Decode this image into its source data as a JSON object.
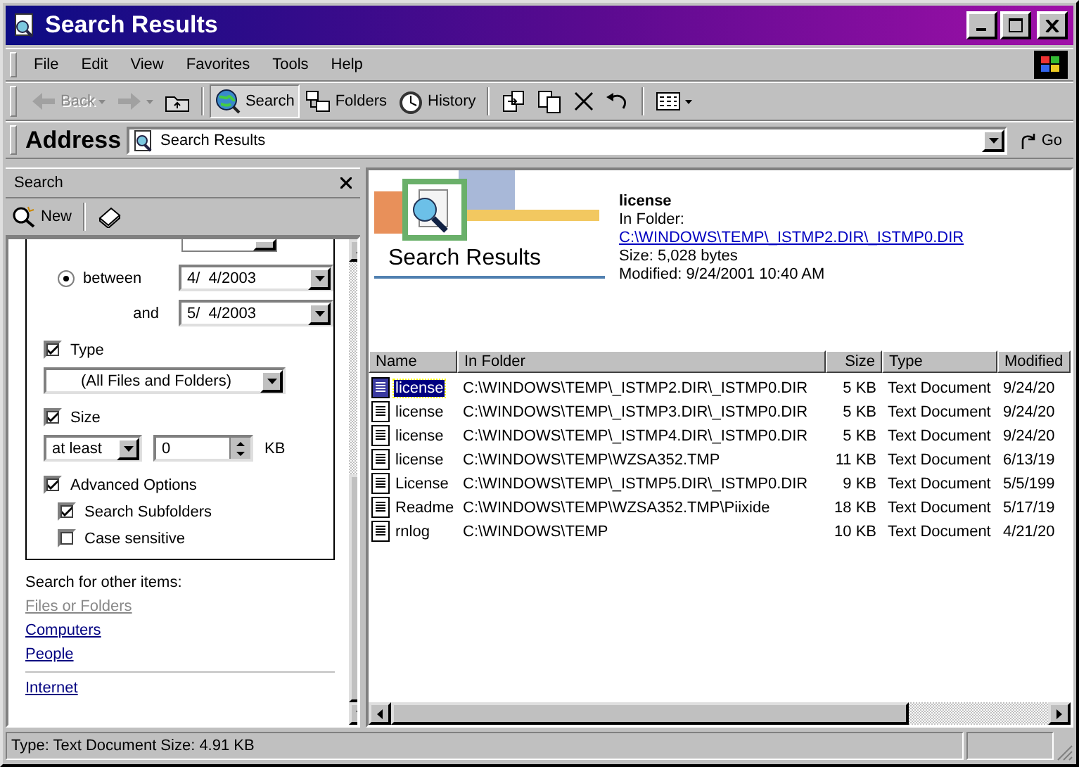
{
  "window": {
    "title": "Search Results"
  },
  "menu": [
    {
      "label": "File"
    },
    {
      "label": "Edit"
    },
    {
      "label": "View"
    },
    {
      "label": "Favorites"
    },
    {
      "label": "Tools"
    },
    {
      "label": "Help"
    }
  ],
  "toolbar": [
    [
      {
        "kind": "back",
        "label": "Back",
        "disabled": true,
        "dropdown": true,
        "selected": false
      },
      {
        "kind": "forward",
        "disabled": true,
        "dropdown": true,
        "selected": false
      },
      {
        "kind": "up",
        "disabled": false,
        "dropdown": false,
        "selected": false
      }
    ],
    [
      {
        "kind": "search",
        "label": "Search",
        "disabled": false,
        "dropdown": false,
        "selected": true
      },
      {
        "kind": "folders",
        "label": "Folders",
        "disabled": false,
        "dropdown": false,
        "selected": false
      },
      {
        "kind": "history",
        "label": "History",
        "disabled": false,
        "dropdown": false,
        "selected": false
      }
    ],
    [
      {
        "kind": "move",
        "disabled": false,
        "dropdown": false,
        "selected": false
      },
      {
        "kind": "copy",
        "disabled": false,
        "dropdown": false,
        "selected": false
      },
      {
        "kind": "delete",
        "disabled": false,
        "dropdown": false,
        "selected": false
      },
      {
        "kind": "undo",
        "disabled": false,
        "dropdown": false,
        "selected": false
      }
    ],
    [
      {
        "kind": "views",
        "disabled": false,
        "dropdown": true,
        "selected": false
      }
    ]
  ],
  "address": {
    "label": "Address",
    "value": "Search Results",
    "go": "Go"
  },
  "search_pane": {
    "title": "Search",
    "new_label": "New",
    "date_range": {
      "selected": true,
      "label": "between",
      "from": "4/  4/2003",
      "and_label": "and",
      "to": "5/  4/2003"
    },
    "type": {
      "label": "Type",
      "checked": true,
      "value": "(All Files and Folders)"
    },
    "size": {
      "label": "Size",
      "checked": true,
      "mode": "at least",
      "value": "0",
      "unit": "KB"
    },
    "advanced": {
      "label": "Advanced Options",
      "checked": true,
      "options": [
        {
          "label": "Search Subfolders",
          "checked": true
        },
        {
          "label": "Case sensitive",
          "checked": false
        }
      ]
    },
    "other_items": {
      "label": "Search for other items:",
      "link_groups": [
        [
          {
            "label": "Files or Folders",
            "disabled": true
          },
          {
            "label": "Computers",
            "disabled": false
          },
          {
            "label": "People",
            "disabled": false
          }
        ],
        [
          {
            "label": "Internet",
            "disabled": false
          }
        ]
      ]
    }
  },
  "details": {
    "banner": "Search Results",
    "name": "license",
    "in_folder_label": "In Folder:",
    "folder": "C:\\WINDOWS\\TEMP\\_ISTMP2.DIR\\_ISTMP0.DIR",
    "size": "Size: 5,028 bytes",
    "modified": "Modified: 9/24/2001 10:40 AM"
  },
  "table": {
    "columns": [
      "Name",
      "In Folder",
      "Size",
      "Type",
      "Modified"
    ],
    "rows": [
      {
        "name": "license",
        "folder": "C:\\WINDOWS\\TEMP\\_ISTMP2.DIR\\_ISTMP0.DIR",
        "size": "5 KB",
        "type": "Text Document",
        "modified": "9/24/20",
        "selected": true
      },
      {
        "name": "license",
        "folder": "C:\\WINDOWS\\TEMP\\_ISTMP3.DIR\\_ISTMP0.DIR",
        "size": "5 KB",
        "type": "Text Document",
        "modified": "9/24/20",
        "selected": false
      },
      {
        "name": "license",
        "folder": "C:\\WINDOWS\\TEMP\\_ISTMP4.DIR\\_ISTMP0.DIR",
        "size": "5 KB",
        "type": "Text Document",
        "modified": "9/24/20",
        "selected": false
      },
      {
        "name": "license",
        "folder": "C:\\WINDOWS\\TEMP\\WZSA352.TMP",
        "size": "11 KB",
        "type": "Text Document",
        "modified": "6/13/19",
        "selected": false
      },
      {
        "name": "License",
        "folder": "C:\\WINDOWS\\TEMP\\_ISTMP5.DIR\\_ISTMP0.DIR",
        "size": "9 KB",
        "type": "Text Document",
        "modified": "5/5/199",
        "selected": false
      },
      {
        "name": "Readme",
        "folder": "C:\\WINDOWS\\TEMP\\WZSA352.TMP\\Piixide",
        "size": "18 KB",
        "type": "Text Document",
        "modified": "5/17/19",
        "selected": false
      },
      {
        "name": "rnlog",
        "folder": "C:\\WINDOWS\\TEMP",
        "size": "10 KB",
        "type": "Text Document",
        "modified": "4/21/20",
        "selected": false
      }
    ]
  },
  "status_bar": "Type: Text Document Size: 4.91 KB"
}
